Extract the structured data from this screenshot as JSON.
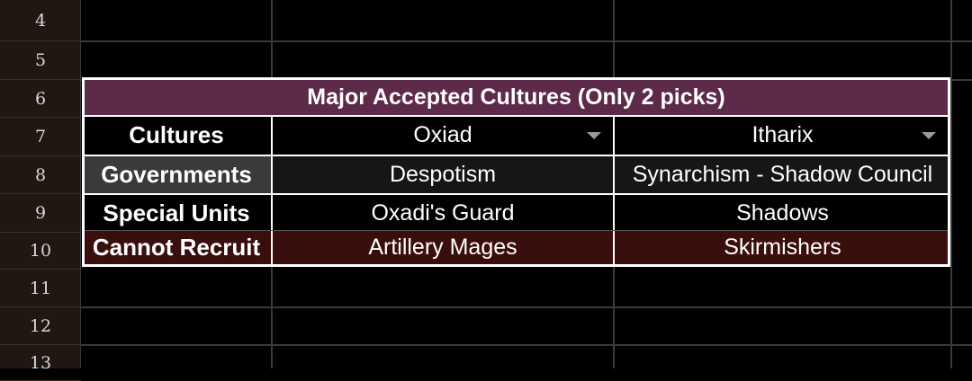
{
  "row_numbers": [
    "4",
    "5",
    "6",
    "7",
    "8",
    "9",
    "10",
    "11",
    "12",
    "13"
  ],
  "table": {
    "title": "Major Accepted Cultures (Only 2 picks)",
    "rows": [
      {
        "label": "Cultures",
        "col1": "Oxiad",
        "col2": "Itharix"
      },
      {
        "label": "Governments",
        "col1": "Despotism",
        "col2": "Synarchism - Shadow Council"
      },
      {
        "label": "Special Units",
        "col1": "Oxadi's Guard",
        "col2": "Shadows"
      },
      {
        "label": "Cannot Recruit",
        "col1": "Artillery Mages",
        "col2": "Skirmishers"
      }
    ]
  },
  "colors": {
    "title_bg": "#5d2a49",
    "governments_label_bg": "#3a3a3a",
    "governments_row_bg": "#161616",
    "cannot_recruit_bg": "#3a0e0c",
    "row_header_bg": "#1f1712"
  },
  "icons": {
    "dropdown": "triangle-down-icon"
  }
}
